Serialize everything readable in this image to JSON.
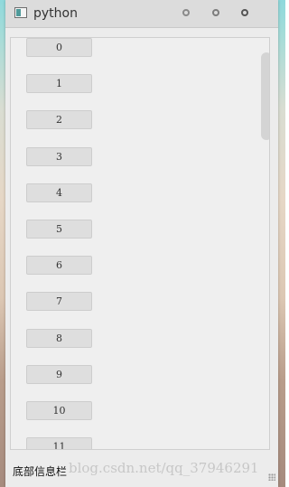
{
  "window": {
    "title": "python",
    "icon": "app-window-icon",
    "controls": [
      "minimize-icon",
      "maximize-icon",
      "close-icon"
    ]
  },
  "list": {
    "buttons": [
      "0",
      "1",
      "2",
      "3",
      "4",
      "5",
      "6",
      "7",
      "8",
      "9",
      "10",
      "11"
    ]
  },
  "status_bar": {
    "text": "底部信息栏",
    "watermark": "blog.csdn.net/qq_37946291"
  }
}
